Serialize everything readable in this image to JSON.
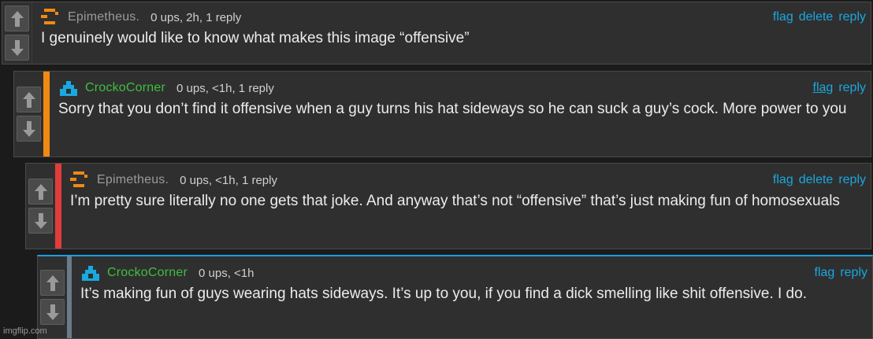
{
  "colors": {
    "accent_link": "#19a8e0",
    "username_orange_user": "#9a9a9a",
    "username_green_user": "#3fbf3f",
    "bar_orange": "#f08a13",
    "bar_red": "#e23c3c",
    "bar_slate": "#6b7a8c",
    "highlight_blue": "#1a9fe0"
  },
  "comments": [
    {
      "username": "Epimetheus.",
      "meta": "0 ups, 2h, 1 reply",
      "actions": {
        "flag": "flag",
        "delete": "delete",
        "reply": "reply"
      },
      "text": "I genuinely would like to know what makes this image “offensive”",
      "avatar_icon": "orange-pixel-avatar-icon"
    },
    {
      "username": "CrockoCorner",
      "meta": "0 ups, <1h, 1 reply",
      "actions": {
        "flag": "flag",
        "reply": "reply"
      },
      "text": "Sorry that you don’t find it offensive when a guy turns his hat sideways so he can suck a guy’s cock. More power to you",
      "avatar_icon": "blue-pixel-avatar-icon"
    },
    {
      "username": "Epimetheus.",
      "meta": "0 ups, <1h, 1 reply",
      "actions": {
        "flag": "flag",
        "delete": "delete",
        "reply": "reply"
      },
      "text": "I’m pretty sure literally no one gets that joke. And anyway that’s not “offensive” that’s just making fun of homosexuals",
      "avatar_icon": "orange-pixel-avatar-icon"
    },
    {
      "username": "CrockoCorner",
      "meta": "0 ups, <1h",
      "actions": {
        "flag": "flag",
        "reply": "reply"
      },
      "text": "It’s making fun of guys wearing hats sideways. It’s up to you, if you find a dick smelling like shit offensive. I do.",
      "avatar_icon": "blue-pixel-avatar-icon"
    }
  ],
  "watermark": "imgflip.com"
}
